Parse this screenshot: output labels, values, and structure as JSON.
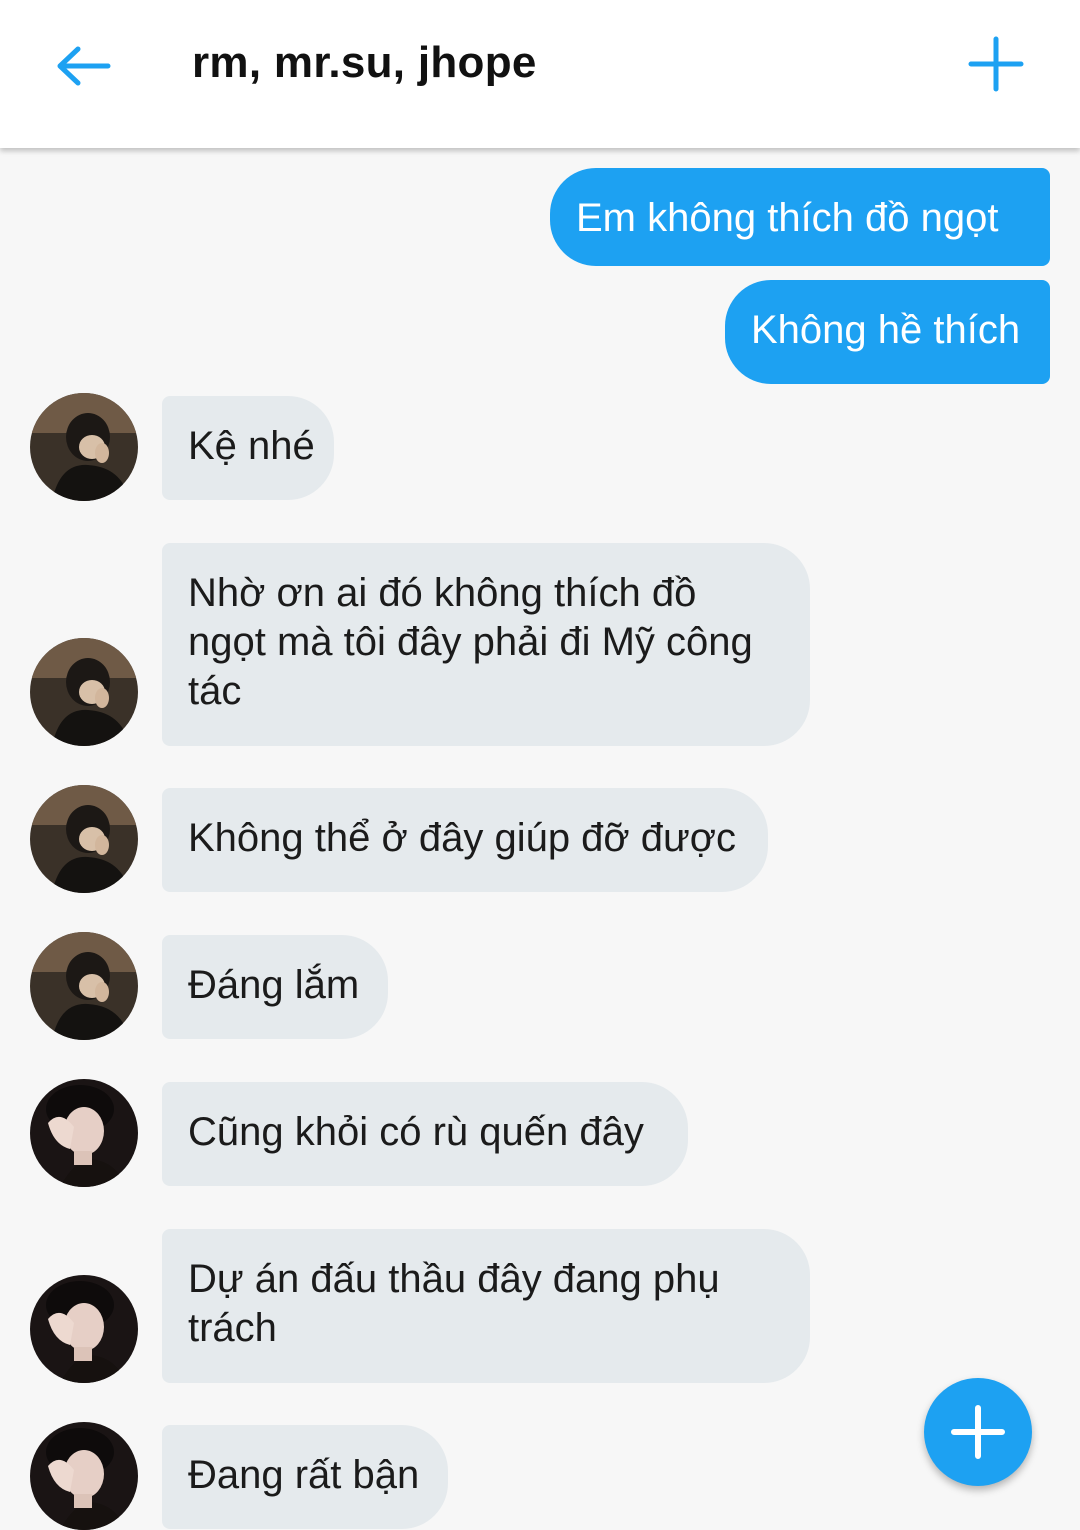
{
  "header": {
    "title": "rm, mr.su, jhope",
    "back_icon": "arrow-left-icon",
    "add_icon": "plus-icon"
  },
  "colors": {
    "accent": "#1da1f2",
    "incoming_bubble": "#e5eaed",
    "background": "#f7f7f7"
  },
  "messages": [
    {
      "direction": "outgoing",
      "text": "Em không thích đồ ngọt"
    },
    {
      "direction": "outgoing",
      "text": "Không hề thích"
    },
    {
      "direction": "incoming",
      "sender_avatar": "avatar-1",
      "text": "Kệ nhé"
    },
    {
      "direction": "incoming",
      "sender_avatar": "avatar-1",
      "text": "Nhờ ơn ai đó không thích đồ ngọt mà tôi đây phải đi Mỹ công tác"
    },
    {
      "direction": "incoming",
      "sender_avatar": "avatar-1",
      "text": "Không thể ở đây giúp đỡ được"
    },
    {
      "direction": "incoming",
      "sender_avatar": "avatar-1",
      "text": "Đáng lắm"
    },
    {
      "direction": "incoming",
      "sender_avatar": "avatar-2",
      "text": "Cũng khỏi có rù quến đây"
    },
    {
      "direction": "incoming",
      "sender_avatar": "avatar-2",
      "text": "Dự án đấu thầu đây đang phụ trách"
    },
    {
      "direction": "incoming",
      "sender_avatar": "avatar-2",
      "text": "Đang rất bận"
    }
  ],
  "fab": {
    "icon": "plus-icon"
  }
}
